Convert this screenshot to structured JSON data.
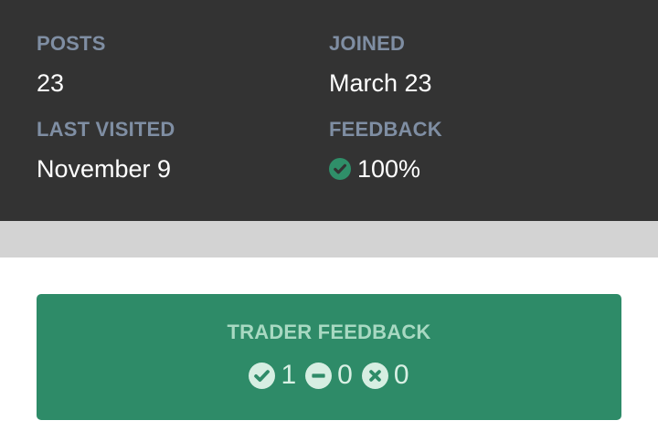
{
  "stats": {
    "posts": {
      "label": "POSTS",
      "value": "23"
    },
    "joined": {
      "label": "JOINED",
      "value": "March 23"
    },
    "last_visited": {
      "label": "LAST VISITED",
      "value": "November 9"
    },
    "feedback": {
      "label": "FEEDBACK",
      "value": "100%",
      "icon": "check-circle-icon"
    }
  },
  "trader_feedback": {
    "title": "TRADER FEEDBACK",
    "positive": {
      "count": "1",
      "icon": "check-circle-icon"
    },
    "neutral": {
      "count": "0",
      "icon": "minus-circle-icon"
    },
    "negative": {
      "count": "0",
      "icon": "x-circle-icon"
    }
  },
  "colors": {
    "stats_background": "#333333",
    "label_color": "#7f8ea3",
    "value_color": "#ffffff",
    "gray_band": "#d3d3d3",
    "card_green": "#2e8b68",
    "check_green": "#2f8f69"
  }
}
